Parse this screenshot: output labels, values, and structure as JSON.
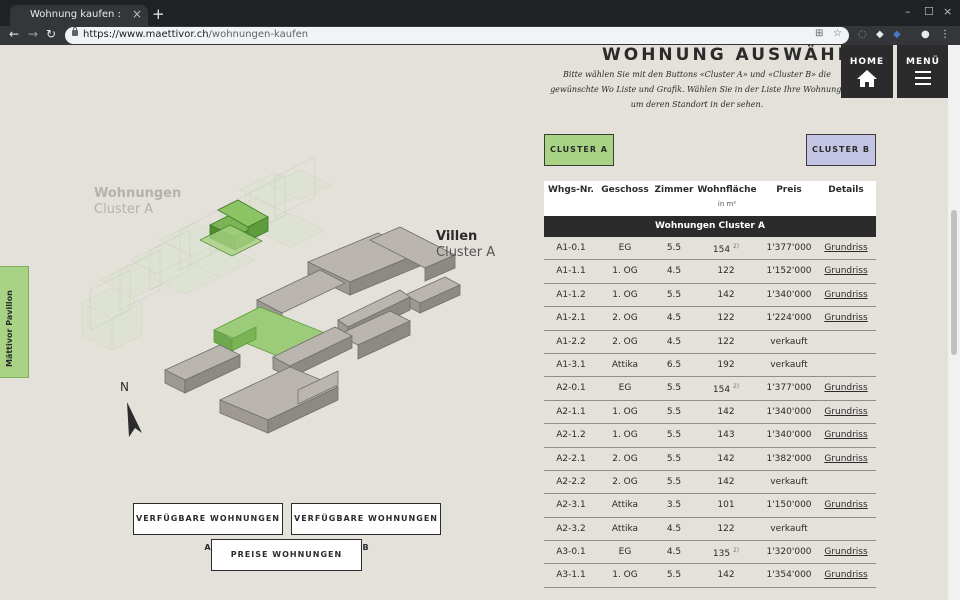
{
  "browser": {
    "tab_title": "Wohnung kaufen : Mättiv",
    "tab_close": "×",
    "new_tab": "+",
    "url_host": "https://www.maettivor.ch",
    "url_path": "/wohnungen-kaufen",
    "controls": {
      "minimize": "–",
      "maximize": "☐",
      "close": "×"
    }
  },
  "page": {
    "heading": "WOHNUNG AUSWÄHLEN",
    "intro": "Bitte wählen Sie mit den Buttons «Cluster A» und «Cluster B» die gewünschte Wo Liste und Grafik. Wählen Sie in der Liste Ihre Wohnung, um deren Standort in der sehen.",
    "home_label": "HOME",
    "menu_label": "MENÜ",
    "cluster_a": "CLUSTER A",
    "cluster_b": "CLUSTER B",
    "side_tab": "Mättivor Pavillon",
    "label_wohnungen": {
      "title": "Wohnungen",
      "sub": "Cluster A"
    },
    "label_villen": {
      "title": "Villen",
      "sub": "Cluster A"
    },
    "compass": "N",
    "buttons": {
      "avail_a": "VERFÜGBARE WOHNUNGEN A",
      "avail_b": "VERFÜGBARE WOHNUNGEN B",
      "prices": "PREISE WOHNUNGEN"
    },
    "colors": {
      "cluster_a": "#a9d384",
      "cluster_b": "#c3c4e3",
      "dark": "#2b2b2b",
      "background": "#e4e0da"
    }
  },
  "table": {
    "headers": {
      "nr": "Whgs-Nr.",
      "geschoss": "Geschoss",
      "zimmer": "Zimmer",
      "flaeche": "Wohnfläche",
      "flaeche_unit": "in m²",
      "preis": "Preis",
      "details": "Details"
    },
    "group": "Wohnungen Cluster A",
    "rows": [
      {
        "nr": "A1-0.1",
        "geschoss": "EG",
        "zimmer": "5.5",
        "flaeche": "154",
        "note": "2)",
        "preis": "1'377'000",
        "details": "Grundriss"
      },
      {
        "nr": "A1-1.1",
        "geschoss": "1. OG",
        "zimmer": "4.5",
        "flaeche": "122",
        "note": "",
        "preis": "1'152'000",
        "details": "Grundriss"
      },
      {
        "nr": "A1-1.2",
        "geschoss": "1. OG",
        "zimmer": "5.5",
        "flaeche": "142",
        "note": "",
        "preis": "1'340'000",
        "details": "Grundriss"
      },
      {
        "nr": "A1-2.1",
        "geschoss": "2. OG",
        "zimmer": "4.5",
        "flaeche": "122",
        "note": "",
        "preis": "1'224'000",
        "details": "Grundriss"
      },
      {
        "nr": "A1-2.2",
        "geschoss": "2. OG",
        "zimmer": "4.5",
        "flaeche": "122",
        "note": "",
        "preis": "verkauft",
        "details": ""
      },
      {
        "nr": "A1-3.1",
        "geschoss": "Attika",
        "zimmer": "6.5",
        "flaeche": "192",
        "note": "",
        "preis": "verkauft",
        "details": ""
      },
      {
        "nr": "A2-0.1",
        "geschoss": "EG",
        "zimmer": "5.5",
        "flaeche": "154",
        "note": "2)",
        "preis": "1'377'000",
        "details": "Grundriss"
      },
      {
        "nr": "A2-1.1",
        "geschoss": "1. OG",
        "zimmer": "5.5",
        "flaeche": "142",
        "note": "",
        "preis": "1'340'000",
        "details": "Grundriss"
      },
      {
        "nr": "A2-1.2",
        "geschoss": "1. OG",
        "zimmer": "5.5",
        "flaeche": "143",
        "note": "",
        "preis": "1'340'000",
        "details": "Grundriss"
      },
      {
        "nr": "A2-2.1",
        "geschoss": "2. OG",
        "zimmer": "5.5",
        "flaeche": "142",
        "note": "",
        "preis": "1'382'000",
        "details": "Grundriss"
      },
      {
        "nr": "A2-2.2",
        "geschoss": "2. OG",
        "zimmer": "5.5",
        "flaeche": "142",
        "note": "",
        "preis": "verkauft",
        "details": ""
      },
      {
        "nr": "A2-3.1",
        "geschoss": "Attika",
        "zimmer": "3.5",
        "flaeche": "101",
        "note": "",
        "preis": "1'150'000",
        "details": "Grundriss"
      },
      {
        "nr": "A2-3.2",
        "geschoss": "Attika",
        "zimmer": "4.5",
        "flaeche": "122",
        "note": "",
        "preis": "verkauft",
        "details": ""
      },
      {
        "nr": "A3-0.1",
        "geschoss": "EG",
        "zimmer": "4.5",
        "flaeche": "135",
        "note": "2)",
        "preis": "1'320'000",
        "details": "Grundriss"
      },
      {
        "nr": "A3-1.1",
        "geschoss": "1. OG",
        "zimmer": "5.5",
        "flaeche": "142",
        "note": "",
        "preis": "1'354'000",
        "details": "Grundriss"
      }
    ]
  }
}
